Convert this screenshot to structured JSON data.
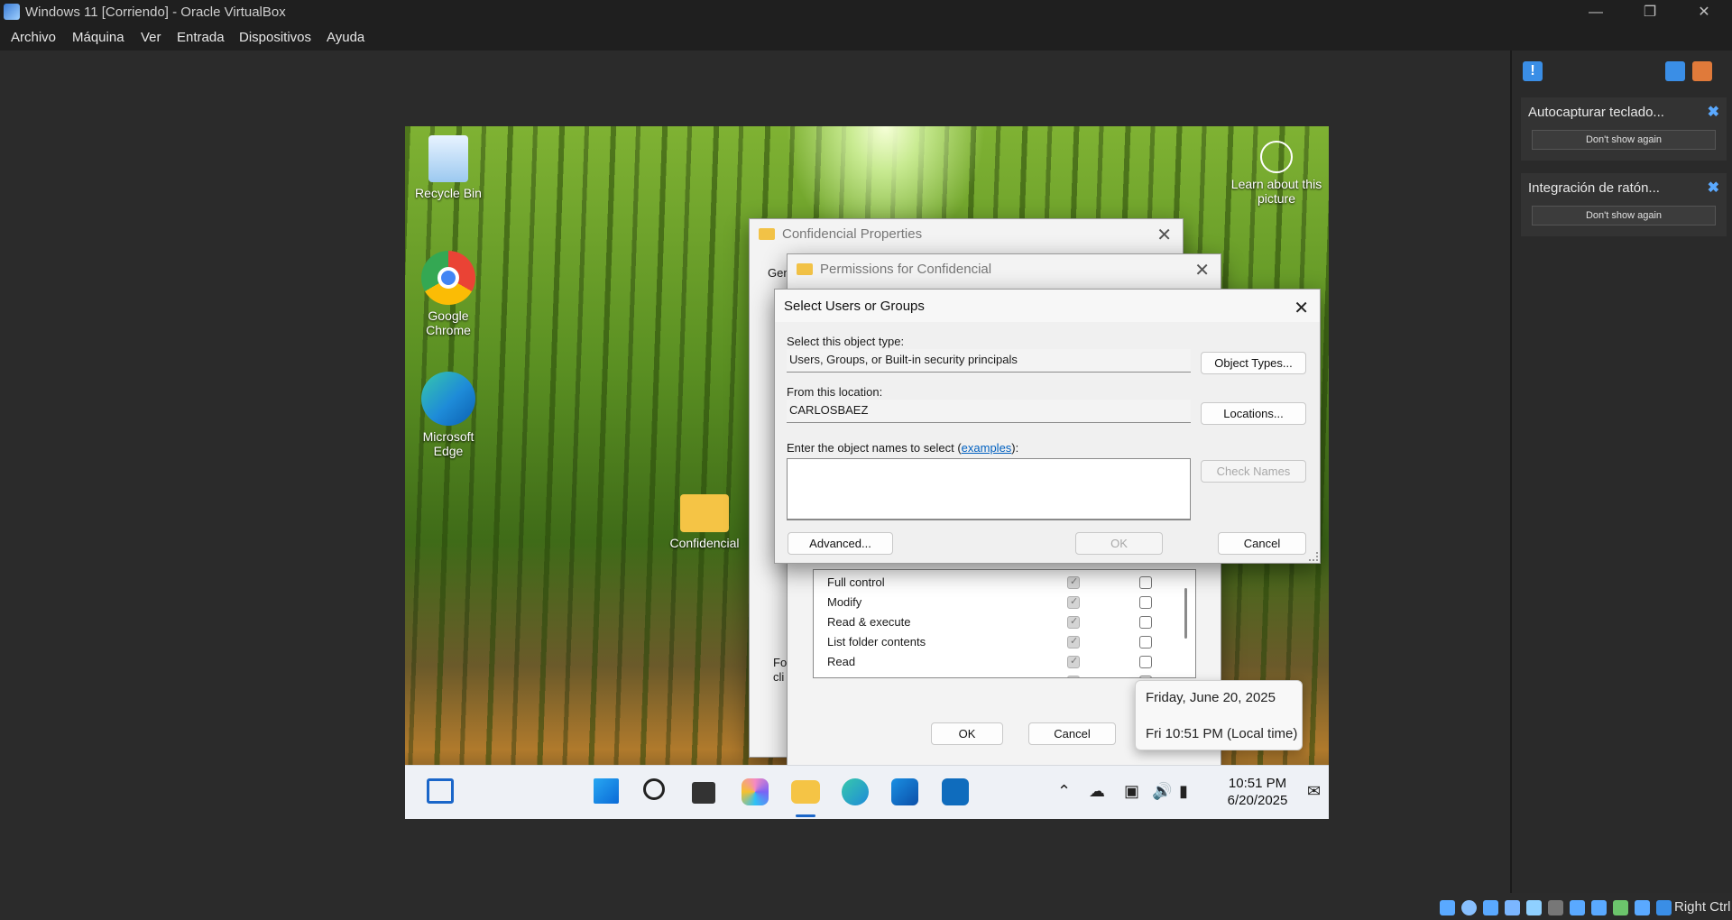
{
  "window": {
    "title": "Windows 11 [Corriendo] - Oracle VirtualBox"
  },
  "menubar": [
    "Archivo",
    "Máquina",
    "Ver",
    "Entrada",
    "Dispositivos",
    "Ayuda"
  ],
  "sidepanel": {
    "cards": [
      {
        "title": "Autocapturar teclado...",
        "button": "Don't show again"
      },
      {
        "title": "Integración de ratón...",
        "button": "Don't show again"
      }
    ]
  },
  "statusbar": {
    "host_key": "Right Ctrl"
  },
  "desktop": {
    "icons": {
      "recycle": "Recycle Bin",
      "chrome": "Google Chrome",
      "edge": "Microsoft Edge",
      "folder": "Confidencial",
      "learn": "Learn about this picture"
    }
  },
  "props_dialog": {
    "title": "Confidencial Properties",
    "tab_fragment": "Gen",
    "bottom_text": "Fo cli"
  },
  "perm_dialog": {
    "title": "Permissions for Confidencial",
    "rows": [
      "Full control",
      "Modify",
      "Read & execute",
      "List folder contents",
      "Read",
      "Wr"
    ],
    "ok": "OK",
    "cancel": "Cancel"
  },
  "select_dialog": {
    "title": "Select Users or Groups",
    "object_type_label": "Select this object type:",
    "object_type_value": "Users, Groups, or Built-in security principals",
    "object_types_btn": "Object Types...",
    "location_label": "From this location:",
    "location_value": "CARLOSBAEZ",
    "locations_btn": "Locations...",
    "names_label_pre": "Enter the object names to select (",
    "names_link": "examples",
    "names_label_post": "):",
    "check_names_btn": "Check Names",
    "advanced_btn": "Advanced...",
    "ok_btn": "OK",
    "cancel_btn": "Cancel"
  },
  "tooltip": {
    "line1": "Friday, June 20, 2025",
    "line2": "Fri 10:51 PM (Local time)"
  },
  "clock": {
    "time": "10:51 PM",
    "date": "6/20/2025"
  }
}
